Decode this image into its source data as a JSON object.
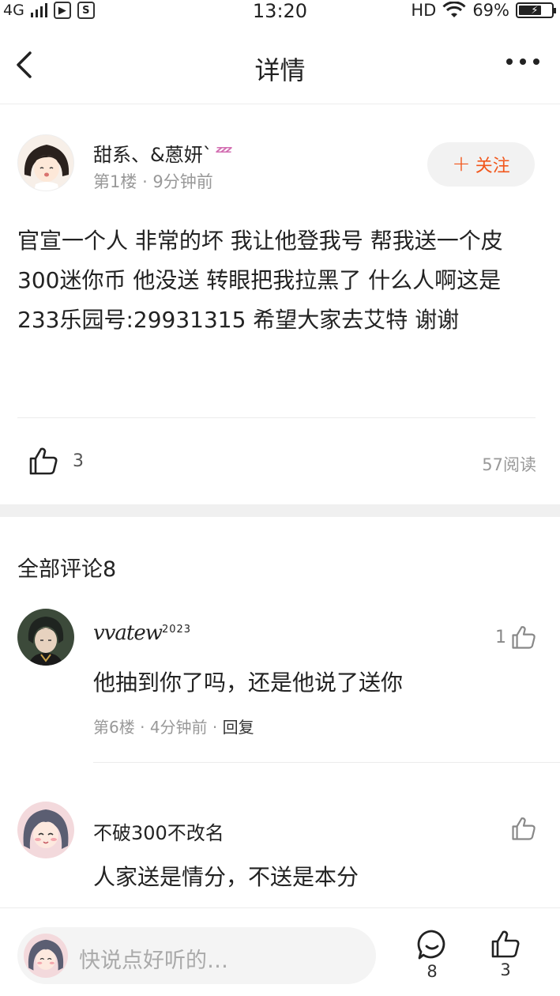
{
  "status_bar": {
    "network": "4G",
    "time": "13:20",
    "hd": "HD",
    "battery": "69%",
    "battery_level": 0.69
  },
  "nav": {
    "title": "详情"
  },
  "post": {
    "author": "甜系、&蒽妍`",
    "floor": "第1楼",
    "time": "9分钟前",
    "follow_label": "关注",
    "body": "官宣一个人 非常的坏 我让他登我号 帮我送一个皮 300迷你币  他没送 转眼把我拉黑了 什么人啊这是 233乐园号:29931315 希望大家去艾特 谢谢",
    "likes": "3",
    "reads": "57阅读"
  },
  "comments": {
    "title": "全部评论8",
    "items": [
      {
        "name": "vvatew",
        "name_sup": "2023",
        "text": "他抽到你了吗，还是他说了送你",
        "floor": "第6楼",
        "time": "4分钟前",
        "reply": "回复",
        "likes": "1"
      },
      {
        "name": "不破300不改名",
        "text": "人家送是情分，不送是本分",
        "likes": ""
      }
    ]
  },
  "bottom_bar": {
    "placeholder": "快说点好听的…",
    "comment_count": "8",
    "like_count": "3"
  },
  "colors": {
    "accent": "#f2571c",
    "muted": "#999999",
    "divider": "#ececec"
  }
}
